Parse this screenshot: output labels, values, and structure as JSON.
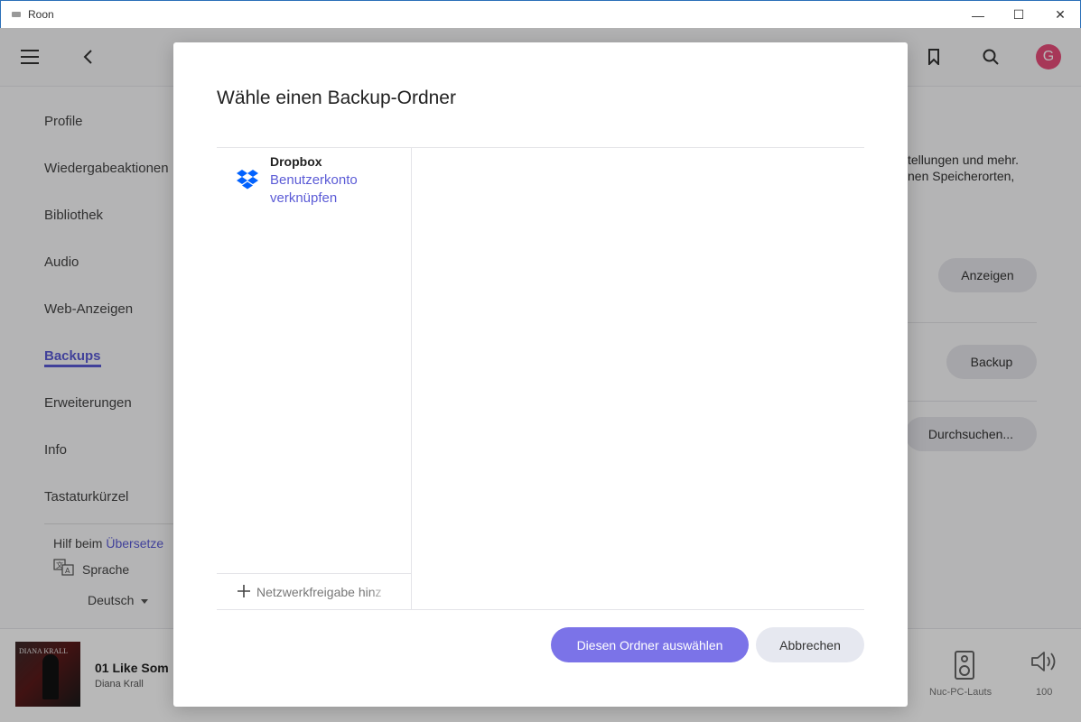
{
  "window": {
    "title": "Roon",
    "minimize": "—",
    "maximize": "☐",
    "close": "✕"
  },
  "topbar": {
    "avatar_letter": "G"
  },
  "sidebar": {
    "items": [
      {
        "label": "Profile"
      },
      {
        "label": "Wiedergabeaktionen"
      },
      {
        "label": "Bibliothek"
      },
      {
        "label": "Audio"
      },
      {
        "label": "Web-Anzeigen"
      },
      {
        "label": "Backups",
        "active": true
      },
      {
        "label": "Erweiterungen"
      },
      {
        "label": "Info"
      },
      {
        "label": "Tastaturkürzel"
      }
    ],
    "help_prefix": "Hilf beim ",
    "help_link": "Übersetze",
    "language_label": "Sprache",
    "language_value": "Deutsch"
  },
  "content": {
    "text_line1": "tellungen und mehr.",
    "text_line2": "nen Speicherorten,",
    "show_button": "Anzeigen",
    "backup_button": "Backup",
    "browse_button": "Durchsuchen..."
  },
  "player": {
    "cover_text": "DIANA KRALL",
    "track_title": "01 Like Som",
    "artist": "Diana Krall",
    "zone_name": "Nuc-PC-Lauts",
    "volume": "100"
  },
  "dialog": {
    "title": "Wähle einen Backup-Ordner",
    "provider": {
      "name": "Dropbox",
      "link": "Benutzerkonto verknüpfen"
    },
    "add_network_share": "Netzwerkfreigabe hinz",
    "select_button": "Diesen Ordner auswählen",
    "cancel_button": "Abbrechen"
  },
  "colors": {
    "accent": "#5b5bd6",
    "primary_button": "#7b73e8",
    "avatar": "#e84d7a",
    "dropbox": "#0061fe"
  }
}
